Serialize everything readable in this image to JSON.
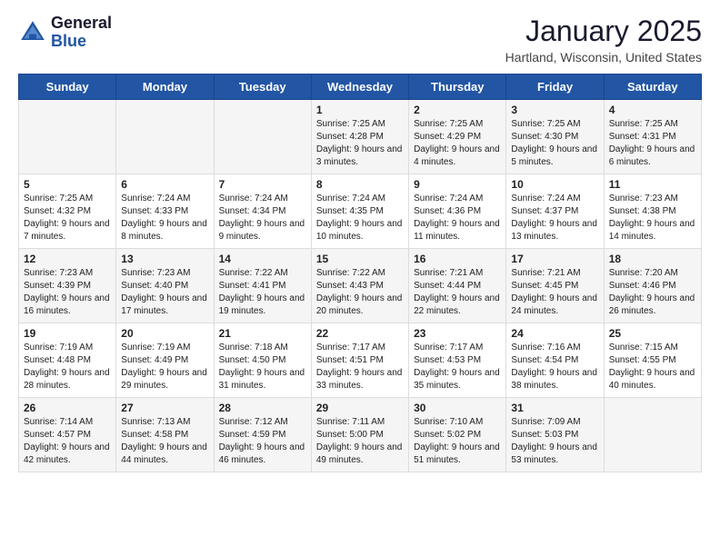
{
  "header": {
    "logo_general": "General",
    "logo_blue": "Blue",
    "month_title": "January 2025",
    "location": "Hartland, Wisconsin, United States"
  },
  "weekdays": [
    "Sunday",
    "Monday",
    "Tuesday",
    "Wednesday",
    "Thursday",
    "Friday",
    "Saturday"
  ],
  "weeks": [
    [
      {
        "day": "",
        "info": ""
      },
      {
        "day": "",
        "info": ""
      },
      {
        "day": "",
        "info": ""
      },
      {
        "day": "1",
        "info": "Sunrise: 7:25 AM\nSunset: 4:28 PM\nDaylight: 9 hours and 3 minutes."
      },
      {
        "day": "2",
        "info": "Sunrise: 7:25 AM\nSunset: 4:29 PM\nDaylight: 9 hours and 4 minutes."
      },
      {
        "day": "3",
        "info": "Sunrise: 7:25 AM\nSunset: 4:30 PM\nDaylight: 9 hours and 5 minutes."
      },
      {
        "day": "4",
        "info": "Sunrise: 7:25 AM\nSunset: 4:31 PM\nDaylight: 9 hours and 6 minutes."
      }
    ],
    [
      {
        "day": "5",
        "info": "Sunrise: 7:25 AM\nSunset: 4:32 PM\nDaylight: 9 hours and 7 minutes."
      },
      {
        "day": "6",
        "info": "Sunrise: 7:24 AM\nSunset: 4:33 PM\nDaylight: 9 hours and 8 minutes."
      },
      {
        "day": "7",
        "info": "Sunrise: 7:24 AM\nSunset: 4:34 PM\nDaylight: 9 hours and 9 minutes."
      },
      {
        "day": "8",
        "info": "Sunrise: 7:24 AM\nSunset: 4:35 PM\nDaylight: 9 hours and 10 minutes."
      },
      {
        "day": "9",
        "info": "Sunrise: 7:24 AM\nSunset: 4:36 PM\nDaylight: 9 hours and 11 minutes."
      },
      {
        "day": "10",
        "info": "Sunrise: 7:24 AM\nSunset: 4:37 PM\nDaylight: 9 hours and 13 minutes."
      },
      {
        "day": "11",
        "info": "Sunrise: 7:23 AM\nSunset: 4:38 PM\nDaylight: 9 hours and 14 minutes."
      }
    ],
    [
      {
        "day": "12",
        "info": "Sunrise: 7:23 AM\nSunset: 4:39 PM\nDaylight: 9 hours and 16 minutes."
      },
      {
        "day": "13",
        "info": "Sunrise: 7:23 AM\nSunset: 4:40 PM\nDaylight: 9 hours and 17 minutes."
      },
      {
        "day": "14",
        "info": "Sunrise: 7:22 AM\nSunset: 4:41 PM\nDaylight: 9 hours and 19 minutes."
      },
      {
        "day": "15",
        "info": "Sunrise: 7:22 AM\nSunset: 4:43 PM\nDaylight: 9 hours and 20 minutes."
      },
      {
        "day": "16",
        "info": "Sunrise: 7:21 AM\nSunset: 4:44 PM\nDaylight: 9 hours and 22 minutes."
      },
      {
        "day": "17",
        "info": "Sunrise: 7:21 AM\nSunset: 4:45 PM\nDaylight: 9 hours and 24 minutes."
      },
      {
        "day": "18",
        "info": "Sunrise: 7:20 AM\nSunset: 4:46 PM\nDaylight: 9 hours and 26 minutes."
      }
    ],
    [
      {
        "day": "19",
        "info": "Sunrise: 7:19 AM\nSunset: 4:48 PM\nDaylight: 9 hours and 28 minutes."
      },
      {
        "day": "20",
        "info": "Sunrise: 7:19 AM\nSunset: 4:49 PM\nDaylight: 9 hours and 29 minutes."
      },
      {
        "day": "21",
        "info": "Sunrise: 7:18 AM\nSunset: 4:50 PM\nDaylight: 9 hours and 31 minutes."
      },
      {
        "day": "22",
        "info": "Sunrise: 7:17 AM\nSunset: 4:51 PM\nDaylight: 9 hours and 33 minutes."
      },
      {
        "day": "23",
        "info": "Sunrise: 7:17 AM\nSunset: 4:53 PM\nDaylight: 9 hours and 35 minutes."
      },
      {
        "day": "24",
        "info": "Sunrise: 7:16 AM\nSunset: 4:54 PM\nDaylight: 9 hours and 38 minutes."
      },
      {
        "day": "25",
        "info": "Sunrise: 7:15 AM\nSunset: 4:55 PM\nDaylight: 9 hours and 40 minutes."
      }
    ],
    [
      {
        "day": "26",
        "info": "Sunrise: 7:14 AM\nSunset: 4:57 PM\nDaylight: 9 hours and 42 minutes."
      },
      {
        "day": "27",
        "info": "Sunrise: 7:13 AM\nSunset: 4:58 PM\nDaylight: 9 hours and 44 minutes."
      },
      {
        "day": "28",
        "info": "Sunrise: 7:12 AM\nSunset: 4:59 PM\nDaylight: 9 hours and 46 minutes."
      },
      {
        "day": "29",
        "info": "Sunrise: 7:11 AM\nSunset: 5:00 PM\nDaylight: 9 hours and 49 minutes."
      },
      {
        "day": "30",
        "info": "Sunrise: 7:10 AM\nSunset: 5:02 PM\nDaylight: 9 hours and 51 minutes."
      },
      {
        "day": "31",
        "info": "Sunrise: 7:09 AM\nSunset: 5:03 PM\nDaylight: 9 hours and 53 minutes."
      },
      {
        "day": "",
        "info": ""
      }
    ]
  ]
}
